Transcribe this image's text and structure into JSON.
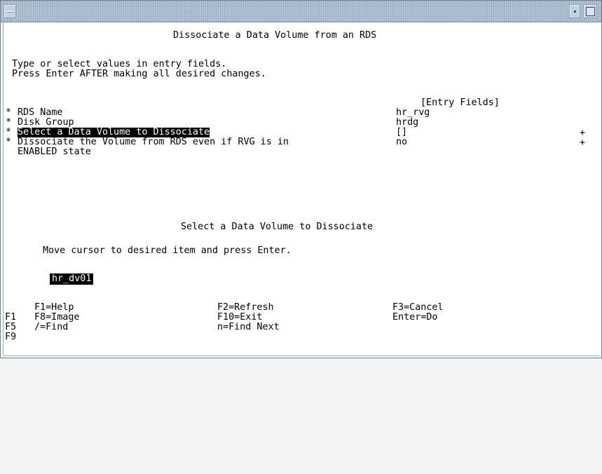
{
  "screen": {
    "title": "Dissociate a Data Volume from an RDS",
    "instructions": [
      "Type or select values in entry fields.",
      "Press Enter AFTER making all desired changes."
    ],
    "entry_fields_header": "[Entry Fields]",
    "fields": [
      {
        "marker": "*",
        "label": "RDS Name",
        "value": "hr_rvg",
        "suffix": ""
      },
      {
        "marker": "*",
        "label": "Disk Group",
        "value": "hrdg",
        "suffix": ""
      },
      {
        "marker": "*",
        "label": "Select a Data Volume to Dissociate",
        "value": "[]",
        "suffix": "+"
      },
      {
        "marker": "*",
        "label": "Dissociate the Volume from RDS even if RVG is in",
        "label2": "ENABLED state",
        "value": "no",
        "suffix": "+"
      }
    ]
  },
  "popup": {
    "title": "Select a Data Volume to Dissociate",
    "instruction": "Move cursor to desired item and press Enter.",
    "items": [
      "hr_dv01"
    ]
  },
  "function_keys": {
    "f1_help": "F1=Help",
    "f2_refresh": "F2=Refresh",
    "f3_cancel": "F3=Cancel",
    "f8_image": "F8=Image",
    "f10_exit": "F10=Exit",
    "enter_do": "Enter=Do",
    "find": "/=Find",
    "find_next": "n=Find Next"
  },
  "left_margin_keys": [
    "F1",
    "F5",
    "F9"
  ]
}
